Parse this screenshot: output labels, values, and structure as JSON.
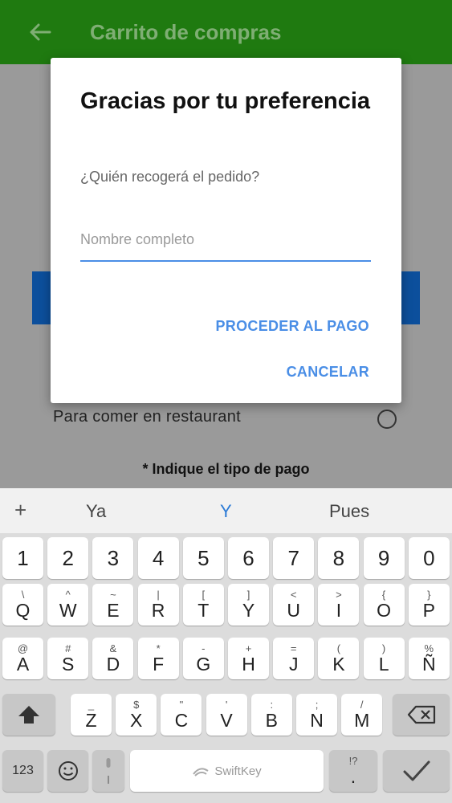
{
  "appbar": {
    "title": "Carrito de compras",
    "back_icon": "arrow-left-icon"
  },
  "background": {
    "dine_option": "Para comer en restaurant",
    "payment_prompt": "* Indique el tipo de pago"
  },
  "dialog": {
    "title": "Gracias por tu preferencia",
    "message": "¿Quién recogerá el pedido?",
    "input_value": "",
    "input_placeholder": "Nombre completo",
    "proceed_label": "PROCEDER AL PAGO",
    "cancel_label": "CANCELAR",
    "accent_color": "#4a8ee6"
  },
  "keyboard": {
    "suggestions": [
      "Ya",
      "Y",
      "Pues"
    ],
    "plus_label": "+",
    "row_numbers": [
      "1",
      "2",
      "3",
      "4",
      "5",
      "6",
      "7",
      "8",
      "9",
      "0"
    ],
    "row1": [
      {
        "alt": "\\",
        "main": "Q"
      },
      {
        "alt": "^",
        "main": "W"
      },
      {
        "alt": "~",
        "main": "E"
      },
      {
        "alt": "|",
        "main": "R"
      },
      {
        "alt": "[",
        "main": "T"
      },
      {
        "alt": "]",
        "main": "Y"
      },
      {
        "alt": "<",
        "main": "U"
      },
      {
        "alt": ">",
        "main": "I"
      },
      {
        "alt": "{",
        "main": "O"
      },
      {
        "alt": "}",
        "main": "P"
      }
    ],
    "row2": [
      {
        "alt": "@",
        "main": "A"
      },
      {
        "alt": "#",
        "main": "S"
      },
      {
        "alt": "&",
        "main": "D"
      },
      {
        "alt": "*",
        "main": "F"
      },
      {
        "alt": "-",
        "main": "G"
      },
      {
        "alt": "+",
        "main": "H"
      },
      {
        "alt": "=",
        "main": "J"
      },
      {
        "alt": "(",
        "main": "K"
      },
      {
        "alt": ")",
        "main": "L"
      },
      {
        "alt": "%",
        "main": "Ñ"
      }
    ],
    "row3": [
      {
        "alt": "_",
        "main": "Z"
      },
      {
        "alt": "$",
        "main": "X"
      },
      {
        "alt": "\"",
        "main": "C"
      },
      {
        "alt": "'",
        "main": "V"
      },
      {
        "alt": ":",
        "main": "B"
      },
      {
        "alt": ";",
        "main": "N"
      },
      {
        "alt": "/",
        "main": "M"
      }
    ],
    "key_123": "123",
    "space_label": "SwiftKey",
    "period_alt": "!?",
    "period": "."
  }
}
